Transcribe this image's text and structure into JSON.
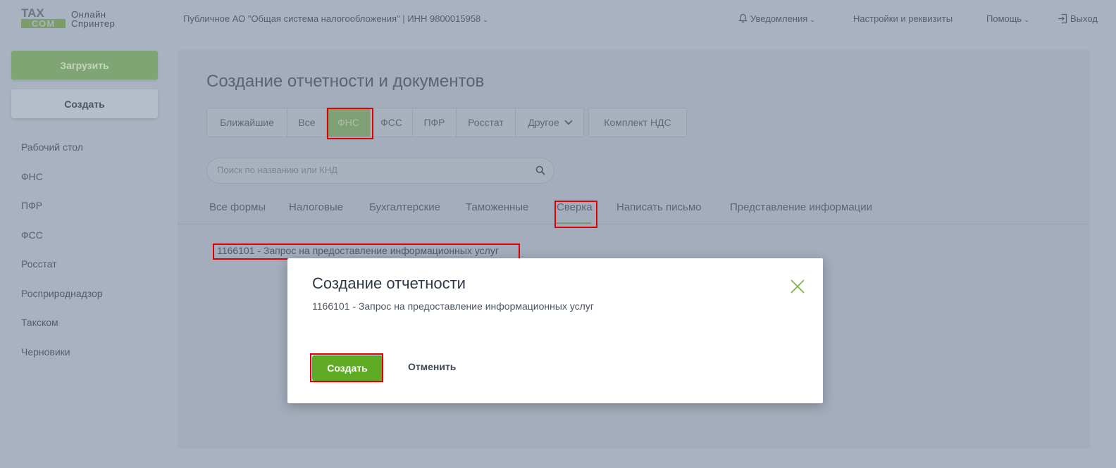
{
  "header": {
    "logo": {
      "top": "TAX",
      "bottom": "COM",
      "line1": "Онлайн",
      "line2": "Спринтер"
    },
    "org": "Публичное АО \"Общая система налогообложения\" | ИНН 9800015958",
    "notifications": "Уведомления",
    "settings": "Настройки и реквизиты",
    "help": "Помощь",
    "logout": "Выход"
  },
  "sidebar": {
    "upload_label": "Загрузить",
    "create_label": "Создать",
    "items": [
      "Рабочий стол",
      "ФНС",
      "ПФР",
      "ФСС",
      "Росстат",
      "Росприроднадзор",
      "Такском",
      "Черновики"
    ]
  },
  "main": {
    "title": "Создание отчетности и документов",
    "category_tabs": [
      "Ближайшие",
      "Все",
      "ФНС",
      "ФСС",
      "ПФР",
      "Росстат",
      "Другое"
    ],
    "active_category": "ФНС",
    "vat_kit": "Комплект НДС",
    "search_placeholder": "Поиск по названию или КНД",
    "sub_tabs": [
      "Все формы",
      "Налоговые",
      "Бухгалтерские",
      "Таможенные",
      "Сверка",
      "Написать письмо",
      "Представление информации"
    ],
    "active_sub_tab": "Сверка",
    "form_item": "1166101 - Запрос на предоставление информационных услуг"
  },
  "modal": {
    "title": "Создание отчетности",
    "text": "1166101 - Запрос на предоставление информационных услуг",
    "create_label": "Создать",
    "cancel_label": "Отменить"
  },
  "colors": {
    "overlay": "#a8b2c0",
    "accent_green": "#5fab23",
    "highlight_red": "#e00000"
  }
}
